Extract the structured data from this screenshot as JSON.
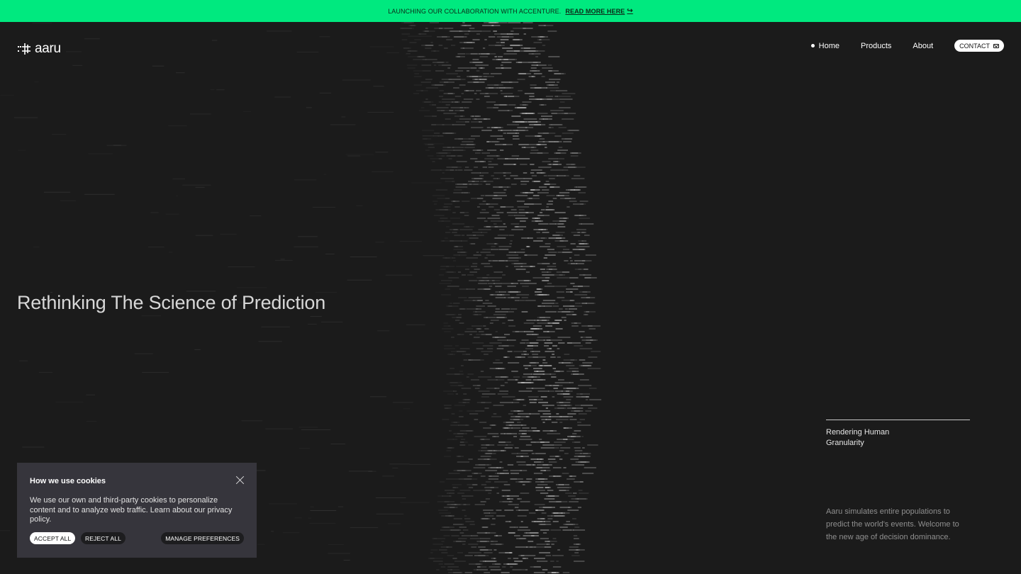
{
  "banner": {
    "text": "LAUNCHING OUR COLLABORATION WITH ACCENTURE.",
    "link_label": "READ MORE HERE",
    "link_icon": "arrow-return-icon",
    "background": "#00e97f"
  },
  "brand": {
    "name": "aaru",
    "logo_icon": "aaru-mark-icon"
  },
  "nav": {
    "home": "Home",
    "products": "Products",
    "about": "About",
    "contact": "CONTACT",
    "contact_icon": "mail-icon"
  },
  "hero": {
    "title": "Rethinking The Science of Prediction"
  },
  "side": {
    "label": "Rendering Human Granularity",
    "description": "Aaru simulates entire populations to predict the world's events. Welcome to the new age of decision dominance."
  },
  "cookie": {
    "title": "How we use cookies",
    "text": "We use our own and third-party cookies to personalize content and to analyze web traffic. Learn about our privacy policy.",
    "accept": "ACCEPT ALL",
    "reject": "REJECT ALL",
    "manage": "MANAGE PREFERENCES",
    "close_icon": "close-icon"
  },
  "colors": {
    "page_background": "#1b1b1b",
    "accent": "#00e97f",
    "cookie_background": "#36353c"
  }
}
